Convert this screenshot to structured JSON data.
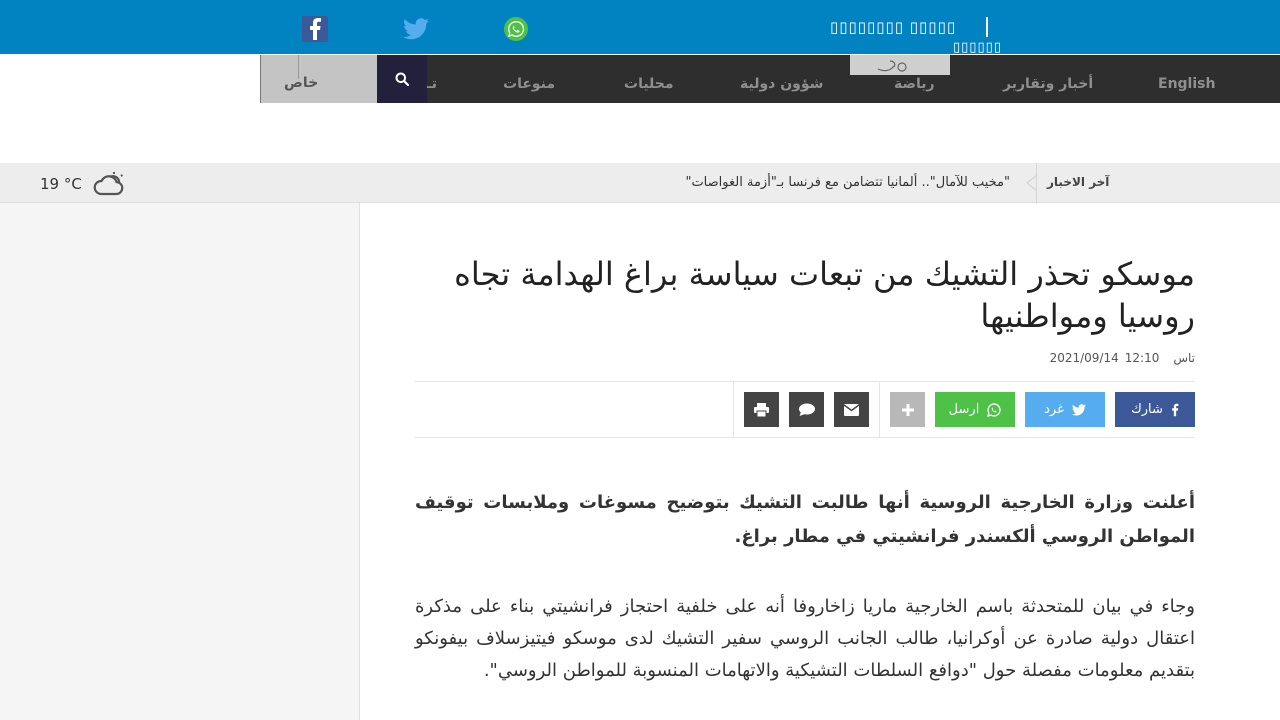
{
  "topbar": {
    "text_main": "▯▯▯▯▯▯▯▯ ▯▯▯▯▯",
    "text_sub": "▯▯▯▯▯▯"
  },
  "nav": {
    "items": [
      "English",
      "أخبار وتقارير",
      "رياضة",
      "شؤون دولية",
      "محليات",
      "منوعات",
      "تـ"
    ],
    "special": "خاص"
  },
  "ticker": {
    "label": "آخر الاخبار",
    "headline": "\"مخيب للآمال\".. ألمانيا تتضامن مع فرنسا بـ\"أزمة الغواصات\""
  },
  "weather": {
    "temp": "19 °C",
    "icon": "cloudy-icon"
  },
  "article": {
    "title": "موسكو تحذر التشيك من تبعات سياسة براغ الهدامة تجاه روسيا ومواطنيها",
    "source": "تاس",
    "time": "12:10",
    "date": "2021/09/14",
    "share": {
      "facebook": "شارك",
      "twitter": "غرد",
      "whatsapp": "ارسل"
    },
    "lead": "أعلنت وزارة الخارجية الروسية أنها طالبت التشيك بتوضيح مسوغات وملابسات توقيف المواطن الروسي ألكسندر فرانشيتي في مطار براغ.",
    "body": "وجاء في بيان للمتحدثة باسم الخارجية ماريا زاخاروفا أنه على خلفية احتجاز فرانشيتي بناء على مذكرة اعتقال دولية صادرة عن أوكرانيا، طالب الجانب الروسي سفير التشيك لدى موسكو فيتيزسلاف بيفونكو بتقديم معلومات مفصلة حول \"دوافع السلطات التشيكية والاتهامات المنسوبة للمواطن الروسي\"."
  },
  "colors": {
    "topbar": "#0283c1",
    "nav": "#2e2e2e",
    "facebook": "#3b5998",
    "twitter": "#55acee",
    "whatsapp": "#4dc247"
  }
}
